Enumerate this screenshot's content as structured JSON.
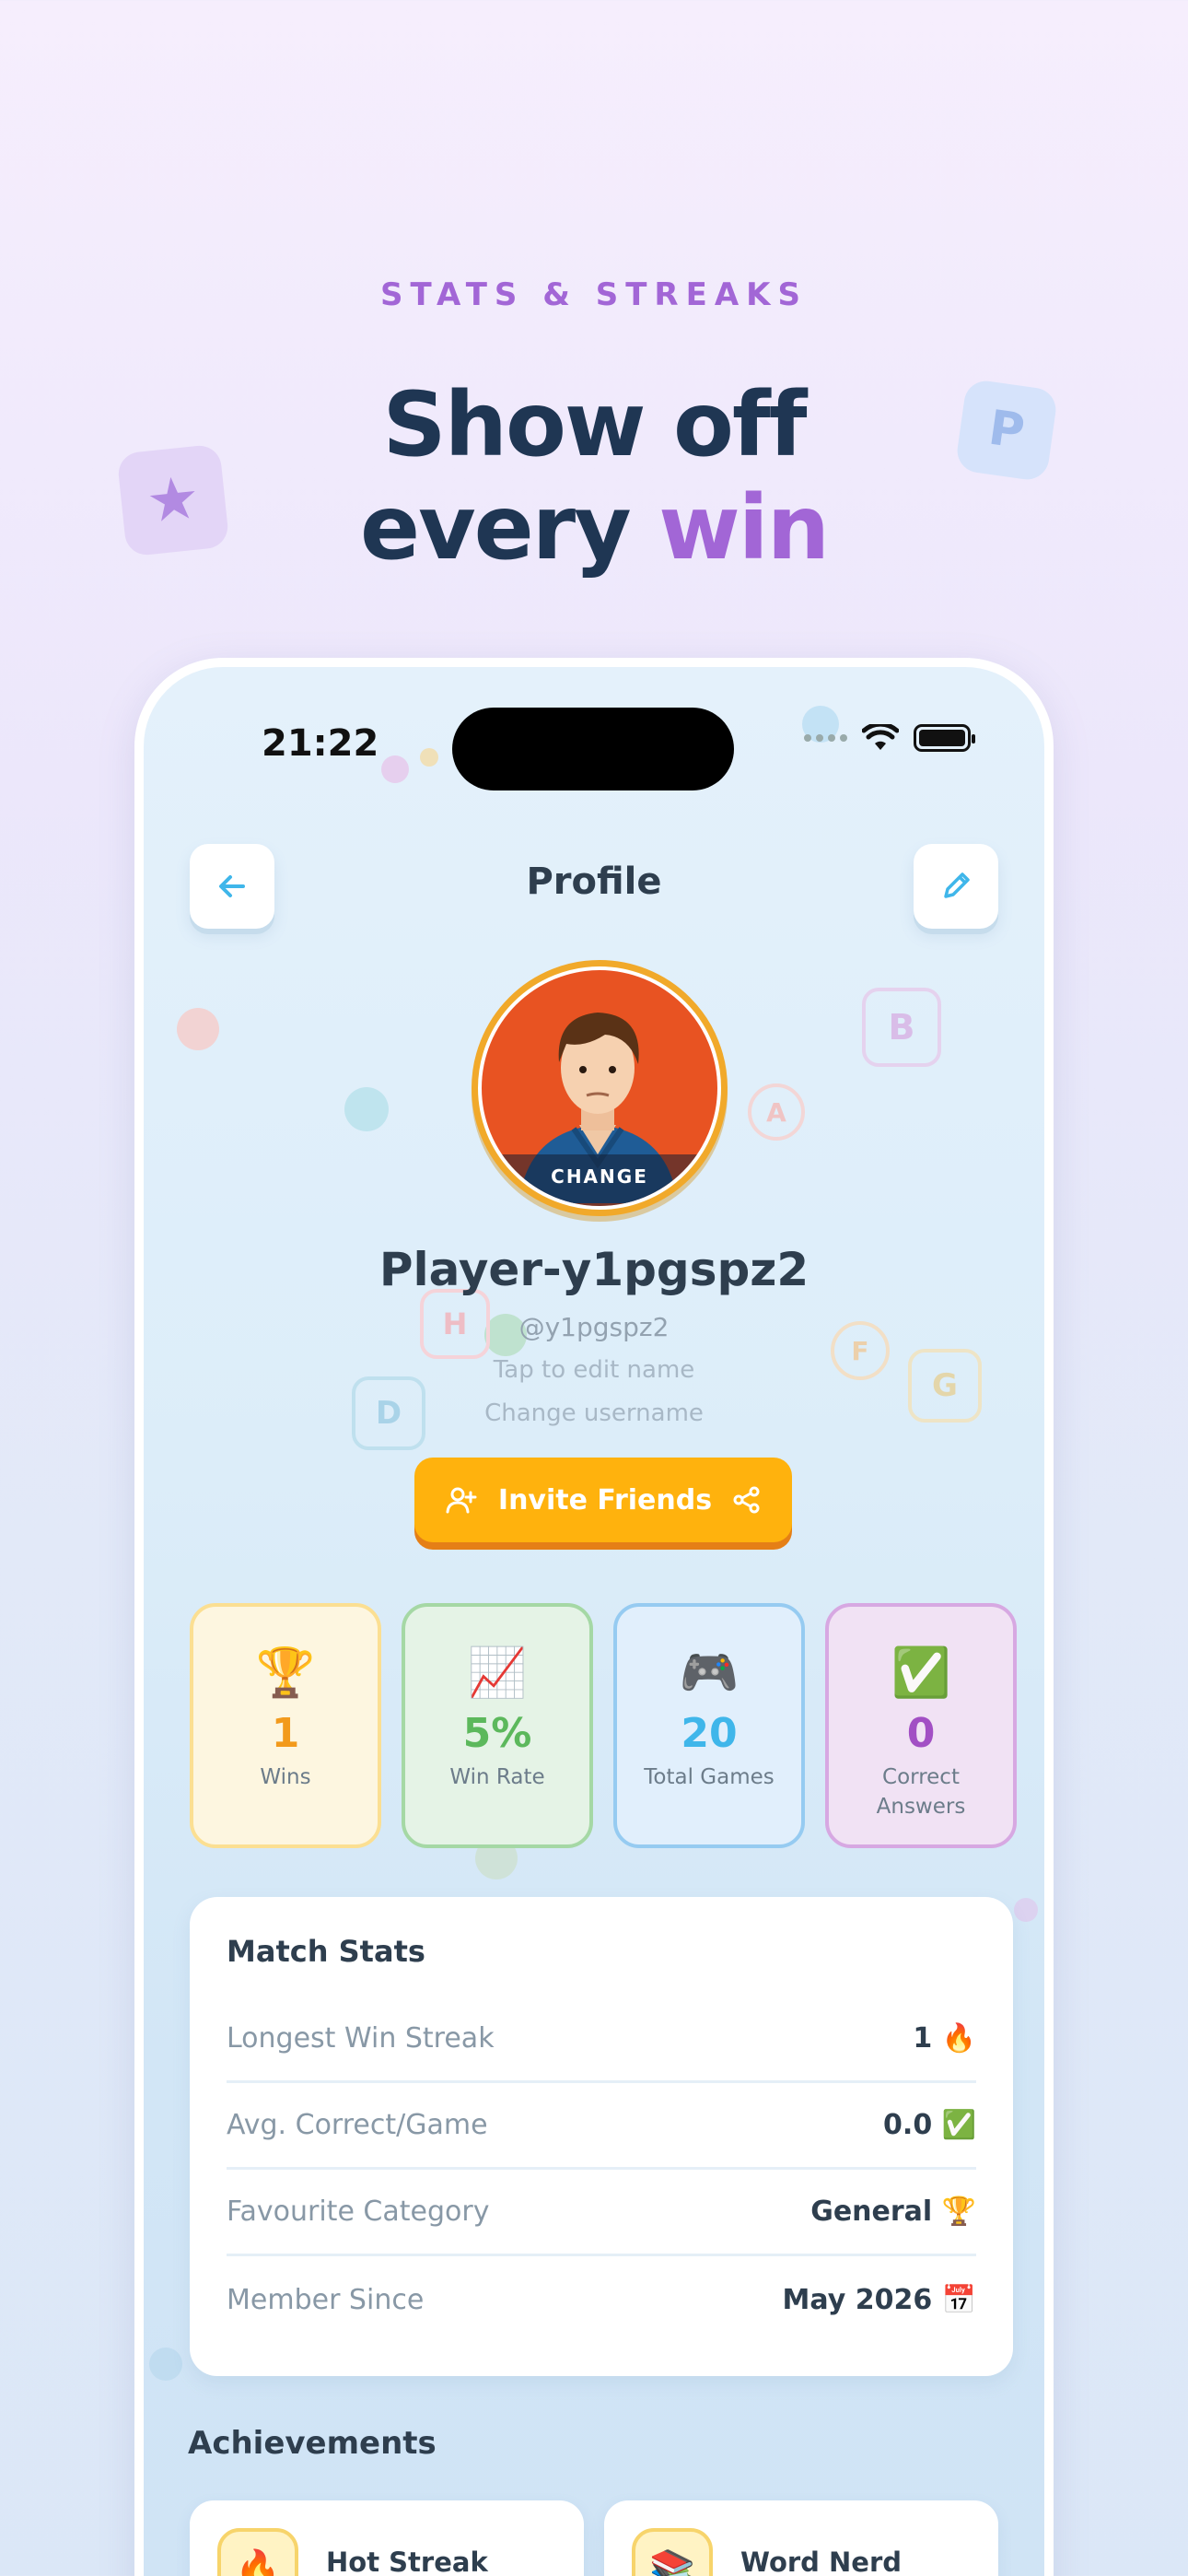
{
  "promo": {
    "kicker": "STATS & STREAKS",
    "headline_line1": "Show off",
    "headline_line2_prefix": "every",
    "headline_line2_accent": "win",
    "deco_left_icon": "star-icon",
    "deco_right_letter": "P"
  },
  "status_bar": {
    "time": "21:22",
    "icons": [
      "signal-dots-icon",
      "wifi-icon",
      "battery-icon"
    ]
  },
  "header": {
    "title": "Profile",
    "back_icon": "arrow-left-icon",
    "edit_icon": "pencil-icon"
  },
  "profile": {
    "avatar_overlay_label": "CHANGE",
    "name": "Player-y1pgspz2",
    "handle": "@y1pgspz2",
    "edit_name_hint": "Tap to edit name",
    "change_username_hint": "Change username",
    "invite_label": "Invite Friends"
  },
  "stats": [
    {
      "emoji": "🏆",
      "value": "1",
      "label": "Wins",
      "color": "#f29a1c"
    },
    {
      "emoji": "📈",
      "value": "5%",
      "label": "Win Rate",
      "color": "#5cb85c"
    },
    {
      "emoji": "🎮",
      "value": "20",
      "label": "Total Games",
      "color": "#3fb6ea"
    },
    {
      "emoji": "✅",
      "value": "0",
      "label": "Correct Answers",
      "color": "#a24fc4"
    }
  ],
  "match_stats": {
    "title": "Match Stats",
    "rows": [
      {
        "key": "Longest Win Streak",
        "value": "1 🔥"
      },
      {
        "key": "Avg. Correct/Game",
        "value": "0.0 ✅"
      },
      {
        "key": "Favourite Category",
        "value": "General 🏆"
      },
      {
        "key": "Member Since",
        "value": "May 2026 📅"
      }
    ]
  },
  "achievements": {
    "title": "Achievements",
    "items": [
      {
        "name": "Hot Streak",
        "emoji": "🔥"
      },
      {
        "name": "Word Nerd",
        "emoji": "📚"
      }
    ]
  },
  "colors": {
    "accent_purple": "#a266d6",
    "navy": "#1f3653",
    "invite_orange": "#ffb20d",
    "avatar_ring": "#f1a92a"
  }
}
